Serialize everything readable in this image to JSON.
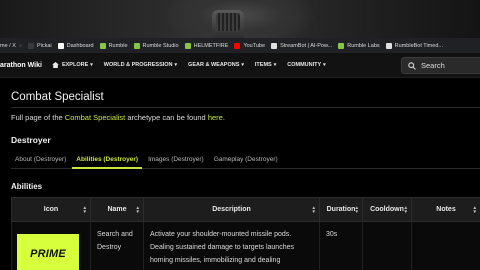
{
  "bookmarks": [
    {
      "label": "me / X",
      "color": "#000000"
    },
    {
      "label": "Pickai",
      "color": "#3a3a3a"
    },
    {
      "label": "Dashboard",
      "color": "#ffffff"
    },
    {
      "label": "Rumble",
      "color": "#85c742"
    },
    {
      "label": "Rumble Studio",
      "color": "#85c742"
    },
    {
      "label": "HELMETFIRE",
      "color": "#85c742"
    },
    {
      "label": "YouTube",
      "color": "#ff0000"
    },
    {
      "label": "StreamBot | AI-Pow...",
      "color": "#e0e0e0"
    },
    {
      "label": "Rumble Labs",
      "color": "#85c742"
    },
    {
      "label": "RumbleBot Timed...",
      "color": "#e0e0e0"
    }
  ],
  "nav": {
    "wiki_title": "arathon Wiki",
    "menu": [
      "EXPLORE",
      "WORLD & PROGRESSION",
      "GEAR & WEAPONS",
      "ITEMS",
      "COMMUNITY"
    ],
    "search_placeholder": "Search"
  },
  "page": {
    "title": "Combat Specialist",
    "intro_before": "Full page of the ",
    "intro_link1": "Combat Specialist",
    "intro_mid": " archetype can be found ",
    "intro_link2": "here",
    "intro_after": ".",
    "subhead": "Destroyer",
    "tabs": [
      "About (Destroyer)",
      "Abilities (Destroyer)",
      "Images (Destroyer)",
      "Gameplay (Destroyer)"
    ],
    "active_tab": "Abilities (Destroyer)",
    "abilities_heading": "Abilities"
  },
  "table": {
    "columns": [
      "Icon",
      "Name",
      "Description",
      "Duration",
      "Cooldown",
      "Notes"
    ],
    "rows": [
      {
        "icon_text": "PRIME",
        "name": "Search and Destroy",
        "description": "Activate your shoulder-mounted missile pods. Dealing sustained damage to targets launches homing missiles, immobilizing and dealing",
        "duration": "30s",
        "cooldown": "",
        "notes": ""
      }
    ]
  },
  "colors": {
    "accent": "#c8e63c",
    "prime_badge": "#d7ff3c"
  }
}
